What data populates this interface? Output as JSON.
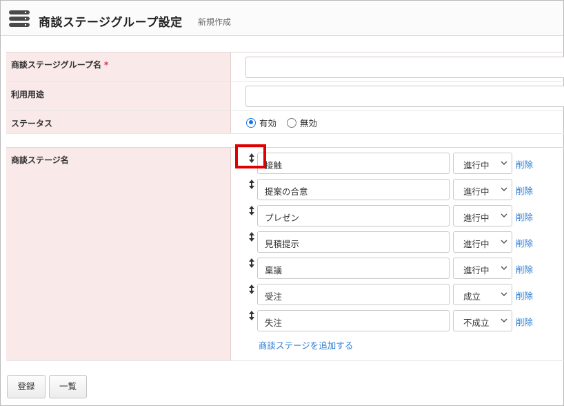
{
  "header": {
    "icon": "server-stack-icon",
    "title": "商談ステージグループ設定",
    "subtitle": "新規作成"
  },
  "form": {
    "group_name": {
      "label": "商談ステージグループ名",
      "required_mark": "*",
      "value": ""
    },
    "usage": {
      "label": "利用用途",
      "value": ""
    },
    "status": {
      "label": "ステータス",
      "options": [
        {
          "label": "有効",
          "checked": true
        },
        {
          "label": "無効",
          "checked": false
        }
      ]
    },
    "stages": {
      "label": "商談ステージ名",
      "items": [
        {
          "name": "接触",
          "status": "進行中",
          "delete": "削除"
        },
        {
          "name": "提案の合意",
          "status": "進行中",
          "delete": "削除"
        },
        {
          "name": "プレゼン",
          "status": "進行中",
          "delete": "削除"
        },
        {
          "name": "見積提示",
          "status": "進行中",
          "delete": "削除"
        },
        {
          "name": "稟議",
          "status": "進行中",
          "delete": "削除"
        },
        {
          "name": "受注",
          "status": "成立",
          "delete": "削除"
        },
        {
          "name": "失注",
          "status": "不成立",
          "delete": "削除"
        }
      ],
      "add_link": "商談ステージを追加する"
    }
  },
  "footer": {
    "register_label": "登録",
    "list_label": "一覧"
  },
  "colors": {
    "label_bg": "#fae9e9",
    "link": "#2a7bd3",
    "highlight": "#e00000",
    "radio_accent": "#1a73e8",
    "required": "#d9363e"
  }
}
